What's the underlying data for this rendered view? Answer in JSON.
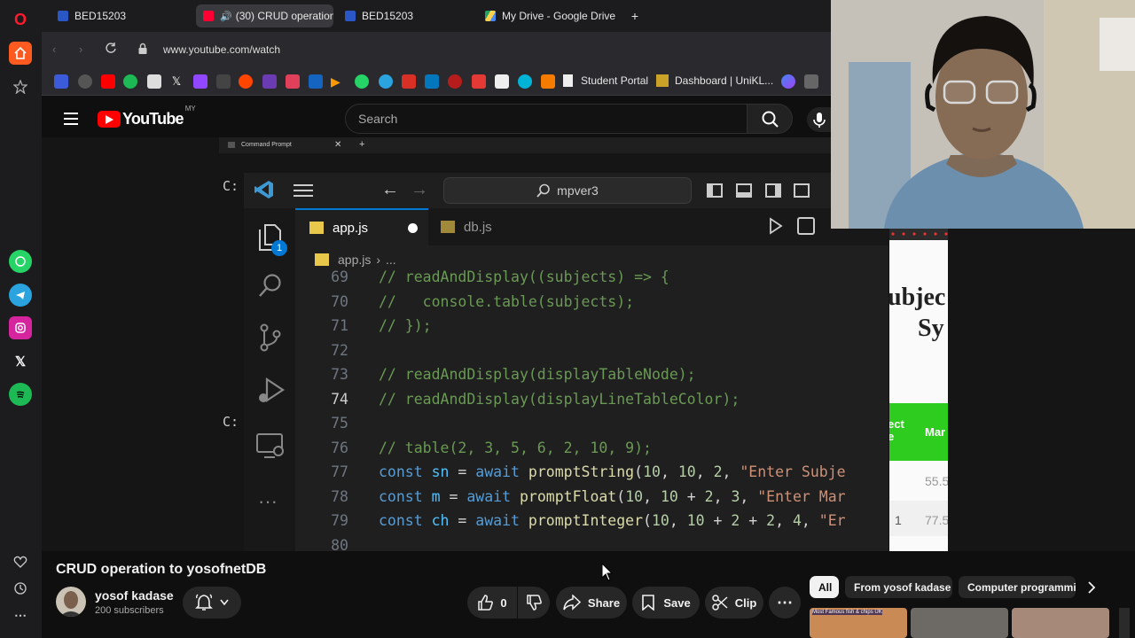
{
  "tabs": [
    {
      "label": "BED15203",
      "active": false
    },
    {
      "label": "(30) CRUD operation t",
      "active": true
    },
    {
      "label": "BED15203",
      "active": false
    },
    {
      "label": "My Drive - Google Drive",
      "active": false
    }
  ],
  "address": {
    "url": "www.youtube.com/watch"
  },
  "bookmarks": [
    {
      "label": "Student Portal"
    },
    {
      "label": "Dashboard | UniKL..."
    }
  ],
  "youtube": {
    "logo_text": "YouTube",
    "region": "MY",
    "search_placeholder": "Search"
  },
  "video": {
    "cmd_title": "Command Prompt",
    "prompt_char_1": "C:",
    "prompt_char_2": "C:",
    "vscode": {
      "search_text": "mpver3",
      "explorer_badge": "1",
      "tabs": [
        {
          "label": "app.js"
        },
        {
          "label": "db.js"
        }
      ],
      "breadcrumb": {
        "file": "app.js",
        "rest": "..."
      },
      "code_lines": [
        {
          "num": "69",
          "text": "// readAndDisplay((subjects) => {"
        },
        {
          "num": "70",
          "text": "//   console.table(subjects);"
        },
        {
          "num": "71",
          "text": "// });"
        },
        {
          "num": "72",
          "text": ""
        },
        {
          "num": "73",
          "text": "// readAndDisplay(displayTableNode);"
        },
        {
          "num": "74",
          "text": "// readAndDisplay(displayLineTableColor);"
        },
        {
          "num": "75",
          "text": ""
        },
        {
          "num": "76",
          "text": "// table(2, 3, 5, 6, 2, 10, 9);"
        },
        {
          "num": "77",
          "text": "const sn = await promptString(10, 10, 2, \"Enter Subje"
        },
        {
          "num": "78",
          "text": "const m = await promptFloat(10, 10 + 2, 3, \"Enter Mar"
        },
        {
          "num": "79",
          "text": "const ch = await promptInteger(10, 10 + 2 + 2, 4, \"Er"
        },
        {
          "num": "80",
          "text": ""
        }
      ]
    },
    "preview": {
      "heading_1": "ubjec",
      "heading_2": "Sy",
      "col_1": "ect",
      "col_1b": "e",
      "col_2": "Mar",
      "val_1": "55.5",
      "row_num": "1",
      "val_2": "77.5"
    }
  },
  "meta": {
    "title": "CRUD operation to yosofnetDB",
    "channel": "yosof kadase",
    "subscribers": "200 subscribers",
    "likes": "0",
    "share_label": "Share",
    "save_label": "Save",
    "clip_label": "Clip"
  },
  "chips": [
    {
      "label": "All",
      "active": true
    },
    {
      "label": "From yosof kadase",
      "active": false
    },
    {
      "label": "Computer programmi",
      "active": false
    }
  ],
  "thumb_caption": "Most Famous fish & chips UK"
}
